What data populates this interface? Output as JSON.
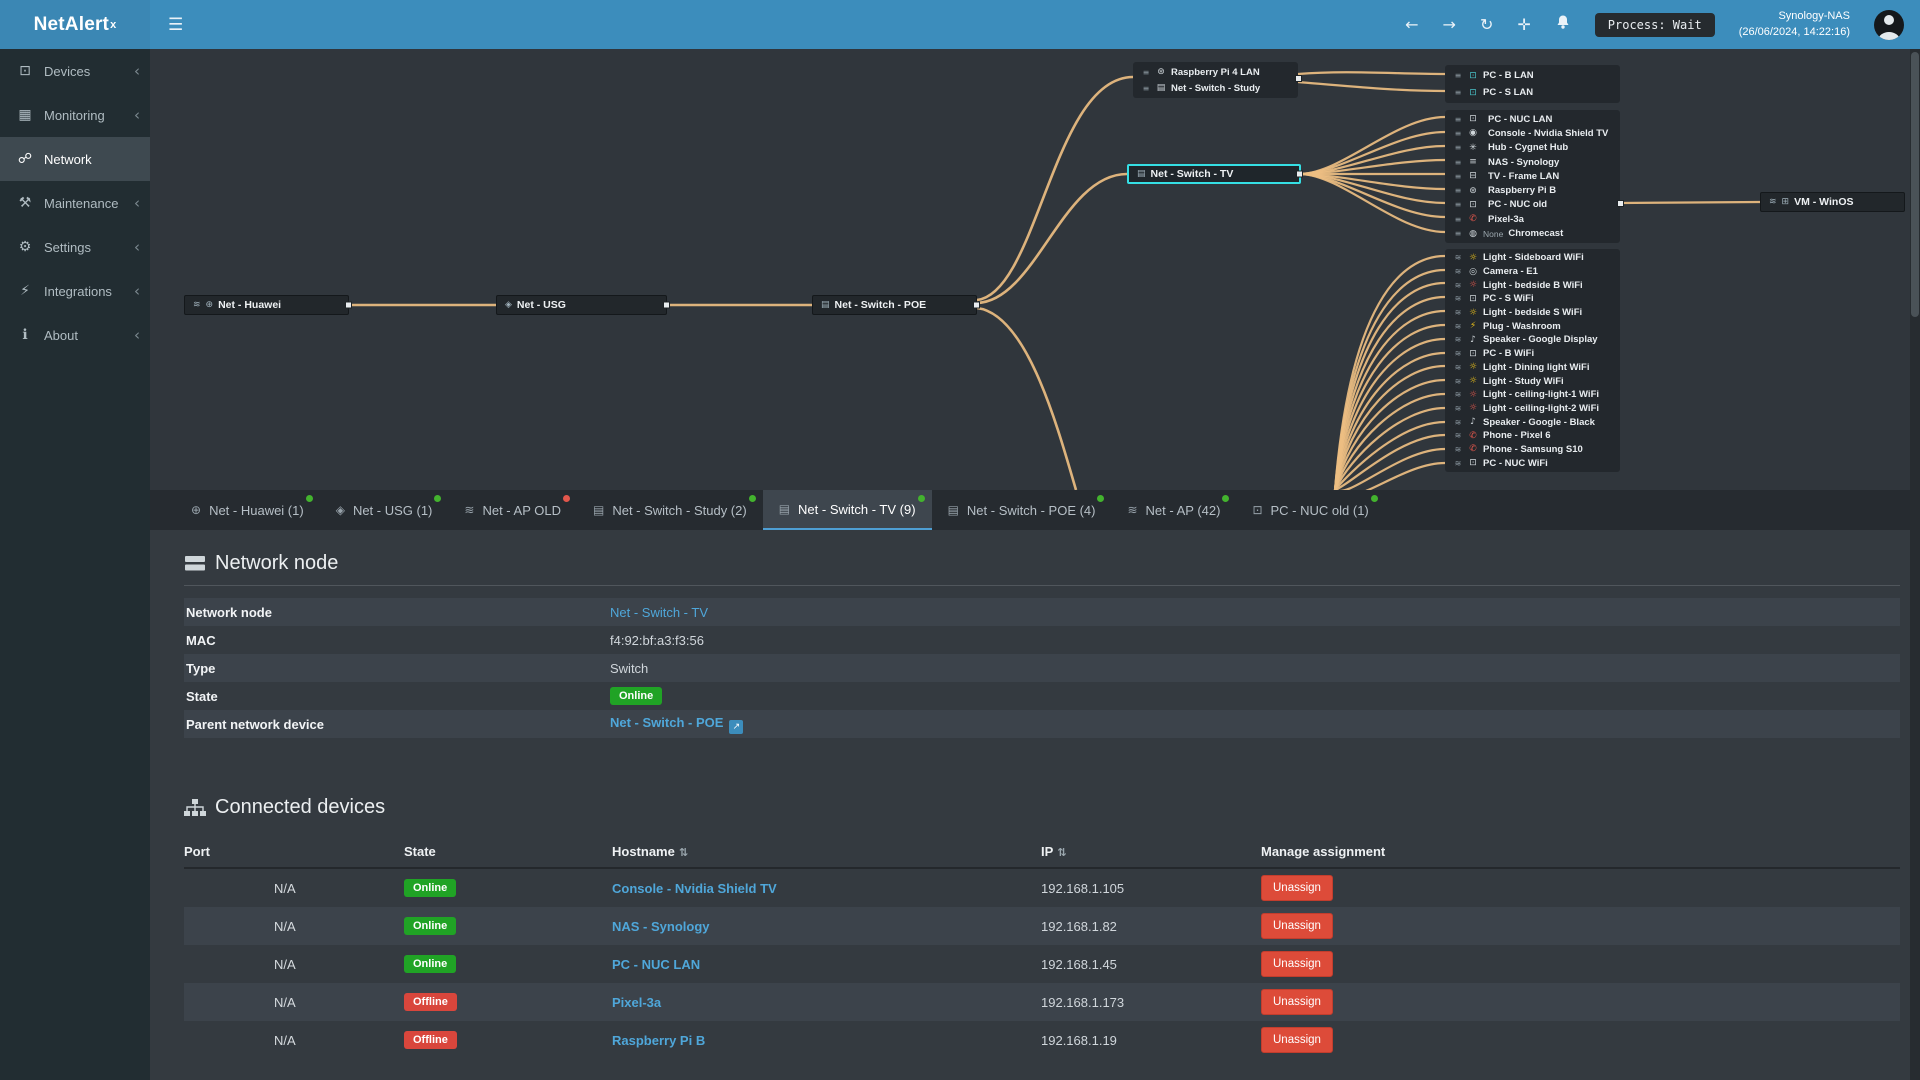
{
  "topbar": {
    "brand": "NetAlert",
    "brand_sup": "x",
    "process_label": "Process: Wait",
    "host": "Synology-NAS",
    "timestamp": "(26/06/2024, 14:22:16)"
  },
  "colors": {
    "topbar": "#3c8dbc",
    "online": "#20a325",
    "offline": "#d9463c",
    "link": "#4fa7da",
    "edge": "#edbe82",
    "selected_node": "#35dfe4",
    "dot_green": "#43b32e",
    "dot_red": "#e2574c"
  },
  "icons": {
    "menu": "☰",
    "back": "←",
    "forward": "→",
    "refresh": "↻",
    "move": "✛",
    "chevron": "‹",
    "sort": "⇅",
    "external": "↗",
    "globe": "⊕",
    "shield": "◈",
    "wifi": "≋",
    "switch": "▤",
    "pc": "⊡",
    "display": "⊡",
    "monitor-chart": "▦",
    "network": "☍",
    "wrench": "⚒",
    "gear": "⚙",
    "plug-sidebar": "⚡",
    "info": "ℹ",
    "raspberry": "⊛",
    "console": "◉",
    "hub": "✳",
    "nas": "≡",
    "tv": "⊟",
    "phone": "✆",
    "cast": "◍",
    "bulb": "☼",
    "camera": "◎",
    "plug": "⚡",
    "speaker": "♪",
    "vm": "⊞",
    "lan": "≡"
  },
  "sidebar": {
    "items": [
      {
        "label": "Devices",
        "icon": "display",
        "chevron": "‹",
        "active_class": ""
      },
      {
        "label": "Monitoring",
        "icon": "monitor-chart",
        "chevron": "‹",
        "active_class": ""
      },
      {
        "label": "Network",
        "icon": "network",
        "chevron": "",
        "active_class": "active"
      },
      {
        "label": "Maintenance",
        "icon": "wrench",
        "chevron": "‹",
        "active_class": ""
      },
      {
        "label": "Settings",
        "icon": "gear",
        "chevron": "‹",
        "active_class": ""
      },
      {
        "label": "Integrations",
        "icon": "plug-sidebar",
        "chevron": "‹",
        "active_class": ""
      },
      {
        "label": "About",
        "icon": "info",
        "chevron": "‹",
        "active_class": ""
      }
    ]
  },
  "diagram": {
    "nodes": {
      "huawei": {
        "label": "Net - Huawei",
        "icon": "globe"
      },
      "usg": {
        "label": "Net - USG",
        "icon": "shield"
      },
      "poe": {
        "label": "Net - Switch - POE",
        "icon": "switch"
      },
      "tv": {
        "label": "Net - Switch - TV",
        "icon": "switch"
      },
      "vm": {
        "label": "VM - WinOS",
        "icon": "vm"
      }
    },
    "boxes": {
      "study": [
        {
          "net": "lan",
          "icon": "raspberry",
          "label": "Raspberry Pi 4 LAN"
        },
        {
          "net": "lan",
          "icon": "switch",
          "label": "Net - Switch - Study"
        }
      ],
      "pcbs": [
        {
          "net": "lan",
          "icon": "pc",
          "label": "PC - B LAN",
          "color": "#49c2c9"
        },
        {
          "net": "lan",
          "icon": "pc",
          "label": "PC - S LAN",
          "color": "#49c2c9"
        }
      ],
      "tv_devices": [
        {
          "net": "lan",
          "icon": "pc",
          "label": "PC - NUC LAN"
        },
        {
          "net": "lan",
          "icon": "console",
          "label": "Console - Nvidia Shield TV"
        },
        {
          "net": "lan",
          "icon": "hub",
          "label": "Hub - Cygnet Hub"
        },
        {
          "net": "lan",
          "icon": "nas",
          "label": "NAS - Synology"
        },
        {
          "net": "lan",
          "icon": "tv",
          "label": "TV - Frame LAN"
        },
        {
          "net": "lan",
          "icon": "raspberry",
          "label": "Raspberry Pi B"
        },
        {
          "net": "lan",
          "icon": "pc",
          "label": "PC - NUC old"
        },
        {
          "net": "lan",
          "icon": "phone",
          "label": "Pixel-3a",
          "color": "#e2574c"
        },
        {
          "net": "lan",
          "icon": "cast",
          "label": "Chromecast",
          "pre": "None"
        }
      ],
      "wifi_devices": [
        {
          "net": "wifi",
          "icon": "bulb",
          "label": "Light - Sideboard WiFi",
          "color": "#f0c419"
        },
        {
          "net": "wifi",
          "icon": "camera",
          "label": "Camera - E1"
        },
        {
          "net": "wifi",
          "icon": "bulb",
          "label": "Light - bedside B WiFi",
          "color": "#e2574c"
        },
        {
          "net": "wifi",
          "icon": "pc",
          "label": "PC - S WiFi"
        },
        {
          "net": "wifi",
          "icon": "bulb",
          "label": "Light - bedside S WiFi",
          "color": "#f0c419"
        },
        {
          "net": "wifi",
          "icon": "plug",
          "label": "Plug - Washroom",
          "color": "#f0c419"
        },
        {
          "net": "wifi",
          "icon": "speaker",
          "label": "Speaker - Google Display"
        },
        {
          "net": "wifi",
          "icon": "pc",
          "label": "PC - B WiFi"
        },
        {
          "net": "wifi",
          "icon": "bulb",
          "label": "Light - Dining light WiFi",
          "color": "#f0c419"
        },
        {
          "net": "wifi",
          "icon": "bulb",
          "label": "Light - Study WiFi",
          "color": "#f0c419"
        },
        {
          "net": "wifi",
          "icon": "bulb",
          "label": "Light - ceiling-light-1 WiFi",
          "color": "#e2574c"
        },
        {
          "net": "wifi",
          "icon": "bulb",
          "label": "Light - ceiling-light-2 WiFi",
          "color": "#e2574c"
        },
        {
          "net": "wifi",
          "icon": "speaker",
          "label": "Speaker - Google - Black"
        },
        {
          "net": "wifi",
          "icon": "phone",
          "label": "Phone - Pixel 6",
          "color": "#e2574c"
        },
        {
          "net": "wifi",
          "icon": "phone",
          "label": "Phone - Samsung S10",
          "color": "#e2574c"
        },
        {
          "net": "wifi",
          "icon": "pc",
          "label": "PC - NUC WiFi"
        }
      ]
    }
  },
  "tabs": [
    {
      "label": "Net - Huawei (1)",
      "icon": "globe",
      "dot": "green",
      "active_class": ""
    },
    {
      "label": "Net - USG (1)",
      "icon": "shield",
      "dot": "green",
      "active_class": ""
    },
    {
      "label": "Net - AP OLD",
      "icon": "wifi",
      "dot": "red",
      "active_class": ""
    },
    {
      "label": "Net - Switch - Study (2)",
      "icon": "switch",
      "dot": "green",
      "active_class": ""
    },
    {
      "label": "Net - Switch - TV (9)",
      "icon": "switch",
      "dot": "green",
      "active_class": "active"
    },
    {
      "label": "Net - Switch - POE (4)",
      "icon": "switch",
      "dot": "green",
      "active_class": ""
    },
    {
      "label": "Net - AP (42)",
      "icon": "wifi",
      "dot": "green",
      "active_class": ""
    },
    {
      "label": "PC - NUC old (1)",
      "icon": "pc",
      "dot": "green",
      "active_class": ""
    }
  ],
  "network_node": {
    "title": "Network node",
    "fields": {
      "node_label": "Network node",
      "node_value": "Net - Switch - TV",
      "mac_label": "MAC",
      "mac_value": "f4:92:bf:a3:f3:56",
      "type_label": "Type",
      "type_value": "Switch",
      "state_label": "State",
      "state_value": "Online",
      "parent_label": "Parent network device",
      "parent_value": "Net - Switch - POE"
    }
  },
  "connected": {
    "title": "Connected devices",
    "columns": {
      "port": "Port",
      "state": "State",
      "hostname": "Hostname",
      "ip": "IP",
      "manage": "Manage assignment"
    },
    "unassign_label": "Unassign",
    "rows": [
      {
        "port": "N/A",
        "state": "Online",
        "hostname": "Console - Nvidia Shield TV",
        "ip": "192.168.1.105"
      },
      {
        "port": "N/A",
        "state": "Online",
        "hostname": "NAS - Synology",
        "ip": "192.168.1.82"
      },
      {
        "port": "N/A",
        "state": "Online",
        "hostname": "PC - NUC LAN",
        "ip": "192.168.1.45"
      },
      {
        "port": "N/A",
        "state": "Offline",
        "hostname": "Pixel-3a",
        "ip": "192.168.1.173"
      },
      {
        "port": "N/A",
        "state": "Offline",
        "hostname": "Raspberry Pi B",
        "ip": "192.168.1.19"
      }
    ]
  }
}
